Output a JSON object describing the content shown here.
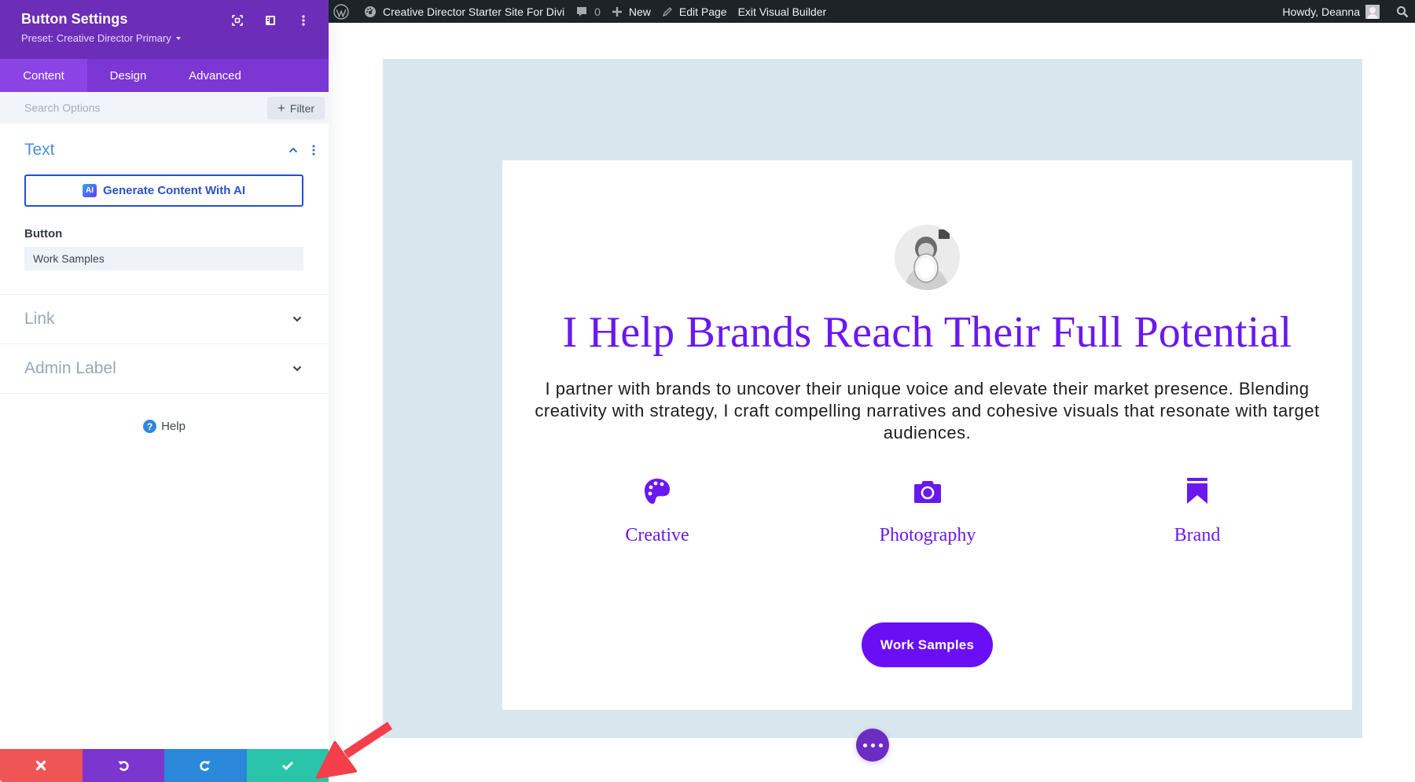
{
  "adminbar": {
    "site_name": "Creative Director Starter Site For Divi",
    "comments_count": "0",
    "new_label": "New",
    "edit_page_label": "Edit Page",
    "exit_label": "Exit Visual Builder",
    "greeting": "Howdy, Deanna"
  },
  "sidebar": {
    "title": "Button Settings",
    "preset": "Preset: Creative Director Primary",
    "tabs": [
      {
        "label": "Content",
        "active": true
      },
      {
        "label": "Design",
        "active": false
      },
      {
        "label": "Advanced",
        "active": false
      }
    ],
    "search_placeholder": "Search Options",
    "filter_label": "Filter",
    "sections": {
      "text": {
        "title": "Text",
        "ai_button_label": "Generate Content With AI",
        "ai_badge": "AI",
        "field_label": "Button",
        "field_value": "Work Samples"
      },
      "link": {
        "title": "Link"
      },
      "admin_label": {
        "title": "Admin Label"
      }
    },
    "help_label": "Help",
    "footer": {
      "discard": "discard",
      "undo": "undo",
      "redo": "redo",
      "save": "save"
    }
  },
  "page": {
    "headline": "I Help Brands Reach Their Full Potential",
    "intro": "I partner with brands to uncover their unique voice and elevate their market presence. Blending creativity with strategy, I craft compelling narratives and cohesive visuals that resonate with target audiences.",
    "features": [
      {
        "icon": "palette-icon",
        "label": "Creative"
      },
      {
        "icon": "camera-icon",
        "label": "Photography"
      },
      {
        "icon": "bookmark-icon",
        "label": "Brand"
      }
    ],
    "cta_label": "Work Samples"
  },
  "colors": {
    "divi_purple": "#6c2eb9",
    "tab_purple": "#7b36d4",
    "brand_violet": "#6a18f0",
    "section_bg": "#d8e6ed",
    "discard_red": "#ef5555",
    "undo_purple": "#7b36cf",
    "redo_blue": "#2b87da",
    "save_teal": "#29c4a9",
    "annotation_red": "#f43f4a"
  }
}
